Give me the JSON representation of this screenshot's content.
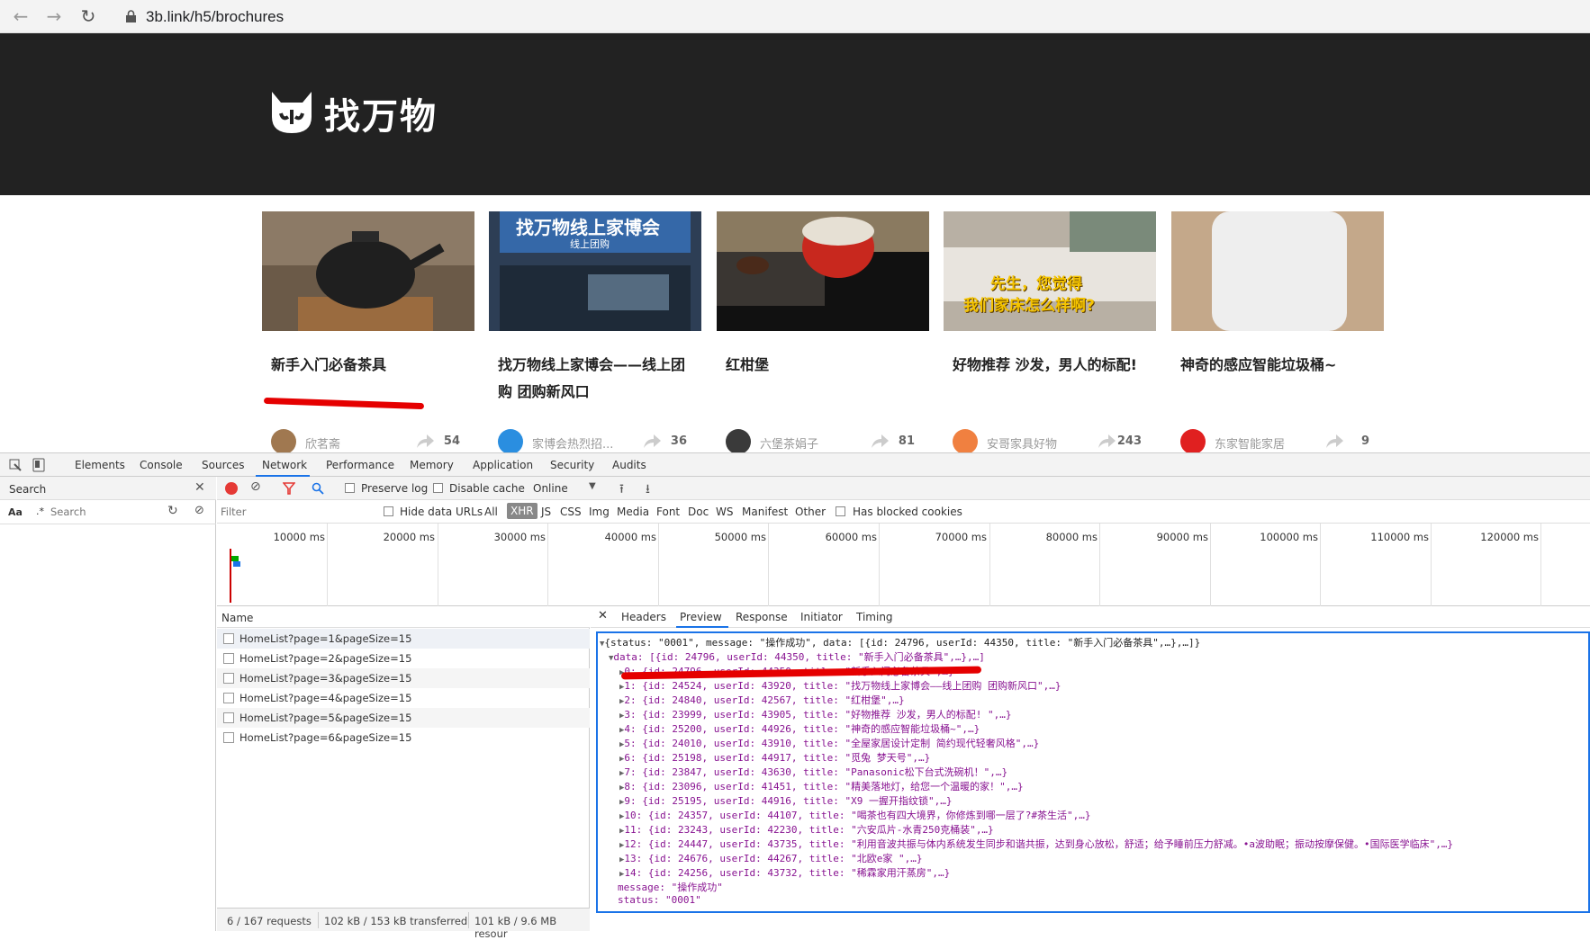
{
  "browser": {
    "url": "3b.link/h5/brochures"
  },
  "site": {
    "logo_text": "找万物"
  },
  "cards": [
    {
      "title": "新手入门必备茶具",
      "author": "欣茗斋",
      "count": "54"
    },
    {
      "title": "找万物线上家博会——线上团购 团购新风口",
      "author": "家博会热烈招...",
      "count": "36",
      "banner_top": "找万物线上家博会",
      "banner_sub": "线上团购"
    },
    {
      "title": "红柑堡",
      "author": "六堡茶娟子",
      "count": "81"
    },
    {
      "title": "好物推荐 沙发，男人的标配!",
      "author": "安哥家具好物",
      "count": "243",
      "overlay_l1": "先生，您觉得",
      "overlay_l2": "我们家床怎么样啊?"
    },
    {
      "title": "神奇的感应智能垃圾桶~",
      "author": "东家智能家居",
      "count": "9"
    }
  ],
  "devtools": {
    "tabs": [
      "Elements",
      "Console",
      "Sources",
      "Network",
      "Performance",
      "Memory",
      "Application",
      "Security",
      "Audits"
    ],
    "search_label": "Search",
    "search_placeholder": "Search",
    "aa": "Aa",
    "regex": ".*",
    "preserve_log": "Preserve log",
    "disable_cache": "Disable cache",
    "throttle": "Online",
    "filter_placeholder": "Filter",
    "hide_data_urls": "Hide data URLs",
    "filter_types": [
      "All",
      "XHR",
      "JS",
      "CSS",
      "Img",
      "Media",
      "Font",
      "Doc",
      "WS",
      "Manifest",
      "Other"
    ],
    "has_blocked": "Has blocked cookies",
    "timeline_labels": [
      "10000 ms",
      "20000 ms",
      "30000 ms",
      "40000 ms",
      "50000 ms",
      "60000 ms",
      "70000 ms",
      "80000 ms",
      "90000 ms",
      "100000 ms",
      "110000 ms",
      "120000 ms"
    ],
    "name_header": "Name",
    "requests": [
      "HomeList?page=1&pageSize=15",
      "HomeList?page=2&pageSize=15",
      "HomeList?page=3&pageSize=15",
      "HomeList?page=4&pageSize=15",
      "HomeList?page=5&pageSize=15",
      "HomeList?page=6&pageSize=15"
    ],
    "status": {
      "requests": "6 / 167 requests",
      "transferred": "102 kB / 153 kB transferred",
      "resources": "101 kB / 9.6 MB resour"
    },
    "preview_tabs": [
      "Headers",
      "Preview",
      "Response",
      "Initiator",
      "Timing"
    ],
    "json_lines": [
      "{status: \"0001\", message: \"操作成功\", data: [{id: 24796, userId: 44350, title: \"新手入门必备茶具\",…},…]}",
      "data: [{id: 24796, userId: 44350, title: \"新手入门必备茶具\",…},…]",
      "0: {id: 24796, userId: 44350, title: \"新手入门必备茶具\",…}",
      "1: {id: 24524, userId: 43920, title: \"找万物线上家博会——线上团购 团购新风口\",…}",
      "2: {id: 24840, userId: 42567, title: \"红柑堡\",…}",
      "3: {id: 23999, userId: 43905, title: \"好物推荐 沙发，男人的标配! \",…}",
      "4: {id: 25200, userId: 44926, title: \"神奇的感应智能垃圾桶~\",…}",
      "5: {id: 24010, userId: 43910, title: \"全屋家居设计定制 简约现代轻奢风格\",…}",
      "6: {id: 25198, userId: 44917, title: \"觅兔 梦天号\",…}",
      "7: {id: 23847, userId: 43630, title: \"Panasonic松下台式洗碗机！\",…}",
      "8: {id: 23096, userId: 41451, title: \"精美落地灯，给您一个温暖的家！\",…}",
      "9: {id: 25195, userId: 44916, title: \"X9 一握开指纹锁\",…}",
      "10: {id: 24357, userId: 44107, title: \"喝茶也有四大境界，你修炼到哪一层了?#茶生活\",…}",
      "11: {id: 23243, userId: 42230, title: \"六安瓜片-水青250克桶装\",…}",
      "12: {id: 24447, userId: 43735, title: \"利用音波共振与体内系统发生同步和谐共振，达到身心放松，舒适；给予睡前压力舒减。•a波助眠；振动按摩保健。•国际医学临床\",…}",
      "13: {id: 24676, userId: 44267, title: \"北欧e家 \",…}",
      "14: {id: 24256, userId: 43732, title: \"稀霖家用汗蒸房\",…}",
      "message: \"操作成功\"",
      "status: \"0001\""
    ]
  }
}
